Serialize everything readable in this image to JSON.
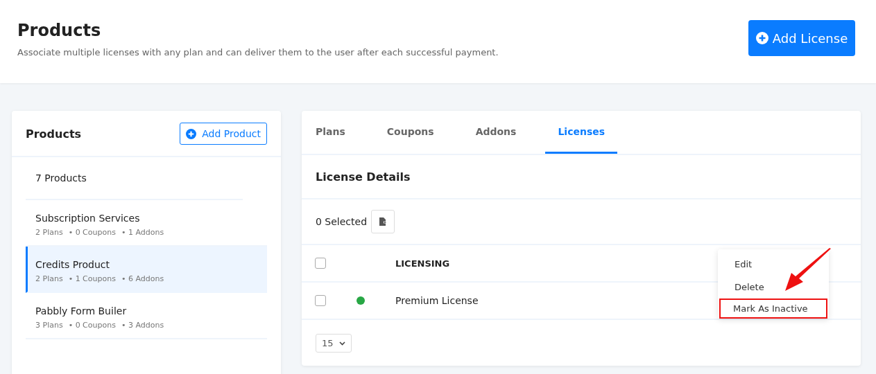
{
  "header": {
    "title": "Products",
    "subtitle": "Associate multiple licenses with any plan and can deliver them to the user after each successful payment.",
    "button": "Add License"
  },
  "products": {
    "title": "Products",
    "add_button": "Add Product",
    "count": "7 Products",
    "items": [
      {
        "name": "Subscription Services",
        "plans": "2 Plans",
        "coupons": "• 0 Coupons",
        "addons": "• 1 Addons",
        "selected": false
      },
      {
        "name": "Credits Product",
        "plans": "2 Plans",
        "coupons": "• 1 Coupons",
        "addons": "• 6 Addons",
        "selected": true
      },
      {
        "name": "Pabbly Form Builer",
        "plans": "3 Plans",
        "coupons": "• 0 Coupons",
        "addons": "• 3 Addons",
        "selected": false
      }
    ]
  },
  "tabs": [
    {
      "label": "Plans",
      "selected": false
    },
    {
      "label": "Coupons",
      "selected": false
    },
    {
      "label": "Addons",
      "selected": false
    },
    {
      "label": "Licenses",
      "selected": true
    }
  ],
  "license_details": {
    "title": "License Details",
    "selected_count": "0 Selected",
    "table": {
      "column": "LICENSING",
      "header_checked": false,
      "rows": [
        {
          "name": "Premium License",
          "checked": false,
          "color": "#28a745"
        }
      ]
    },
    "page_size": "15"
  },
  "context_menu": {
    "items": [
      {
        "label": "Edit",
        "highlighted": false
      },
      {
        "label": "Delete",
        "highlighted": false
      },
      {
        "label": "Mark As Inactive",
        "highlighted": true
      }
    ]
  }
}
